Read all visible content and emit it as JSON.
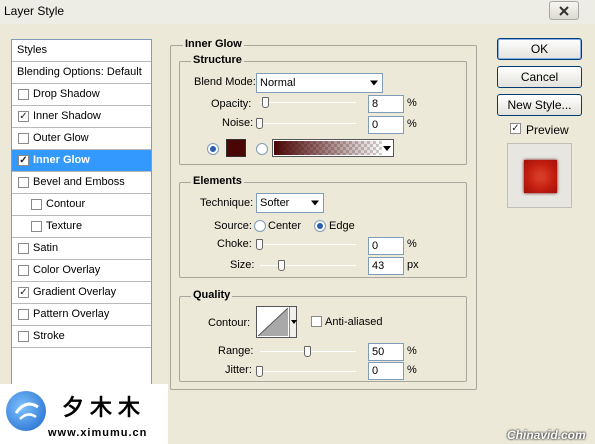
{
  "window": {
    "title": "Layer Style"
  },
  "styles_list": [
    {
      "label": "Styles",
      "checkbox": false
    },
    {
      "label": "Blending Options: Default",
      "checkbox": false
    },
    {
      "label": "Drop Shadow",
      "checkbox": true,
      "checked": false
    },
    {
      "label": "Inner Shadow",
      "checkbox": true,
      "checked": true
    },
    {
      "label": "Outer Glow",
      "checkbox": true,
      "checked": false
    },
    {
      "label": "Inner Glow",
      "checkbox": true,
      "checked": true,
      "selected": true
    },
    {
      "label": "Bevel and Emboss",
      "checkbox": true,
      "checked": false
    },
    {
      "label": "Contour",
      "checkbox": true,
      "checked": false,
      "indent": true
    },
    {
      "label": "Texture",
      "checkbox": true,
      "checked": false,
      "indent": true
    },
    {
      "label": "Satin",
      "checkbox": true,
      "checked": false
    },
    {
      "label": "Color Overlay",
      "checkbox": true,
      "checked": false
    },
    {
      "label": "Gradient Overlay",
      "checkbox": true,
      "checked": true
    },
    {
      "label": "Pattern Overlay",
      "checkbox": true,
      "checked": false
    },
    {
      "label": "Stroke",
      "checkbox": true,
      "checked": false
    }
  ],
  "panel": {
    "title": "Inner Glow",
    "structure": {
      "title": "Structure",
      "blend_mode_label": "Blend Mode:",
      "blend_mode_value": "Normal",
      "opacity_label": "Opacity:",
      "opacity_value": "8",
      "opacity_unit": "%",
      "noise_label": "Noise:",
      "noise_value": "0",
      "noise_unit": "%",
      "glow_color": "#4a0505"
    },
    "elements": {
      "title": "Elements",
      "technique_label": "Technique:",
      "technique_value": "Softer",
      "source_label": "Source:",
      "source_center": "Center",
      "source_edge": "Edge",
      "choke_label": "Choke:",
      "choke_value": "0",
      "choke_unit": "%",
      "size_label": "Size:",
      "size_value": "43",
      "size_unit": "px"
    },
    "quality": {
      "title": "Quality",
      "contour_label": "Contour:",
      "anti_aliased_label": "Anti-aliased",
      "range_label": "Range:",
      "range_value": "50",
      "range_unit": "%",
      "jitter_label": "Jitter:",
      "jitter_value": "0",
      "jitter_unit": "%"
    }
  },
  "buttons": {
    "ok": "OK",
    "cancel": "Cancel",
    "new_style": "New Style..."
  },
  "preview": {
    "label": "Preview",
    "checked": true
  },
  "watermark": {
    "chinese": "夕木木",
    "url": "www.ximumu.cn",
    "corner": "Chinavid.com"
  },
  "colors": {
    "selection": "#3399ff",
    "dialog_bg": "#ece9d8",
    "preview_red": "#c41e10"
  }
}
